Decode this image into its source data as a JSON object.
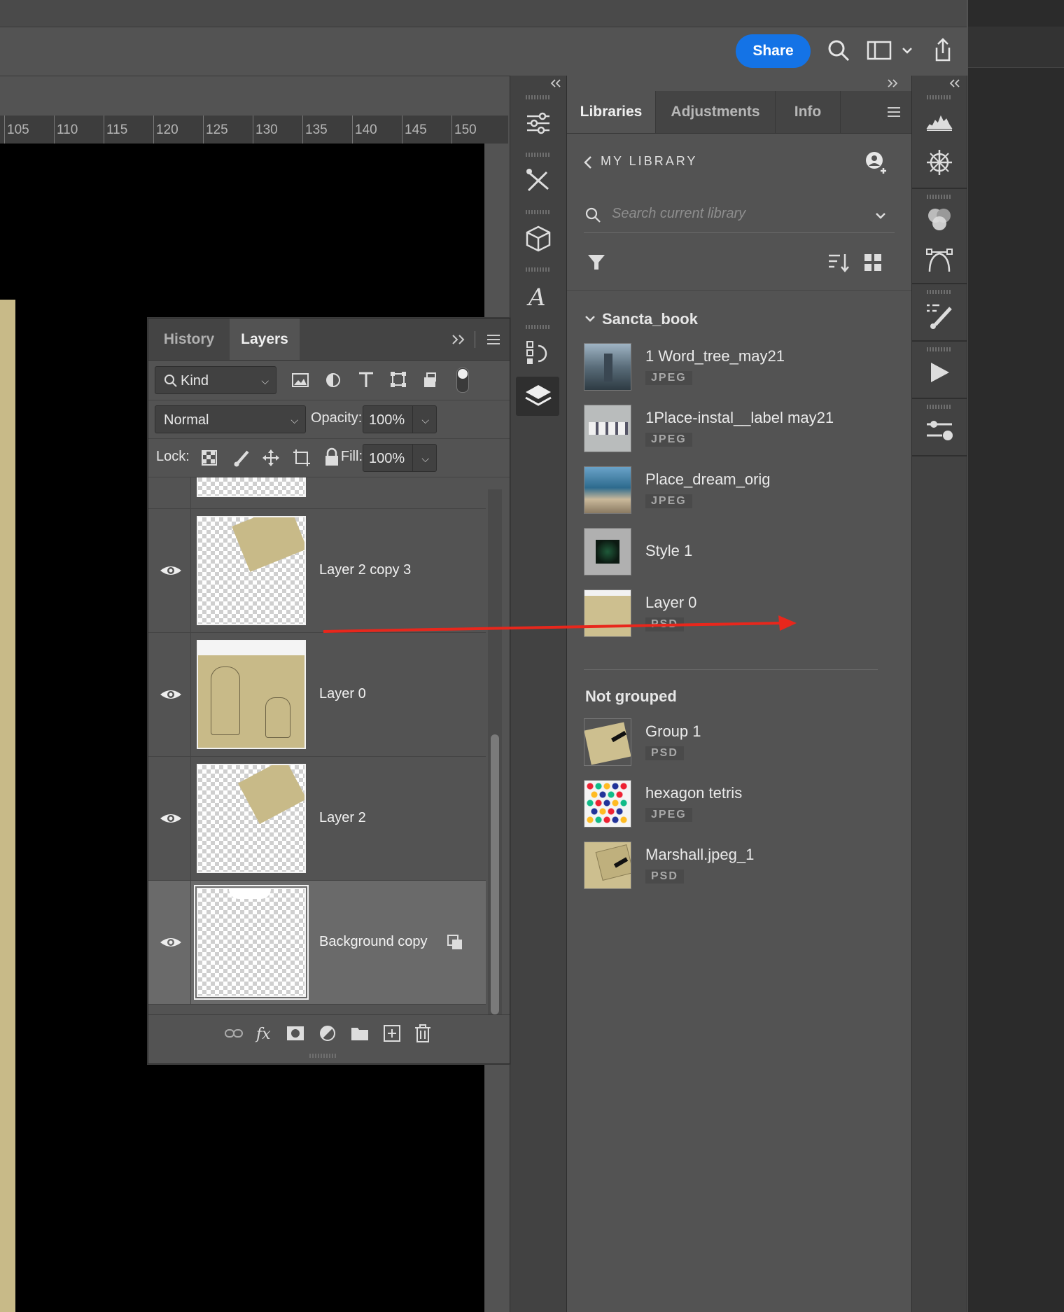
{
  "topbar": {
    "share_label": "Share"
  },
  "ruler": {
    "ticks": [
      "105",
      "110",
      "115",
      "120",
      "125",
      "130",
      "135",
      "140",
      "145",
      "150"
    ]
  },
  "libraries": {
    "tabs": [
      "Libraries",
      "Adjustments",
      "Info"
    ],
    "back_label": "MY LIBRARY",
    "search_placeholder": "Search current library",
    "groups": [
      {
        "name": "Sancta_book",
        "items": [
          {
            "name": "1 Word_tree_may21",
            "type": "JPEG"
          },
          {
            "name": "1Place-instal__label may21",
            "type": "JPEG"
          },
          {
            "name": "Place_dream_orig",
            "type": "JPEG"
          },
          {
            "name": "Style 1",
            "type": ""
          },
          {
            "name": "Layer 0",
            "type": "PSD"
          }
        ]
      },
      {
        "name": "Not grouped",
        "items": [
          {
            "name": "Group 1",
            "type": "PSD"
          },
          {
            "name": "hexagon tetris",
            "type": "JPEG"
          },
          {
            "name": "Marshall.jpeg_1",
            "type": "PSD"
          }
        ]
      }
    ]
  },
  "layers_panel": {
    "tabs": [
      "History",
      "Layers"
    ],
    "filter_kind": "Kind",
    "blend_mode": "Normal",
    "opacity_label": "Opacity:",
    "opacity_value": "100%",
    "lock_label": "Lock:",
    "fill_label": "Fill:",
    "fill_value": "100%",
    "layers": [
      {
        "name": "Layer 2 copy 3",
        "selected": false
      },
      {
        "name": "Layer 0",
        "selected": false
      },
      {
        "name": "Layer 2",
        "selected": false
      },
      {
        "name": "Background copy",
        "selected": true
      }
    ]
  },
  "colors": {
    "accent": "#1473e6",
    "annotation_arrow": "#e8271c"
  }
}
